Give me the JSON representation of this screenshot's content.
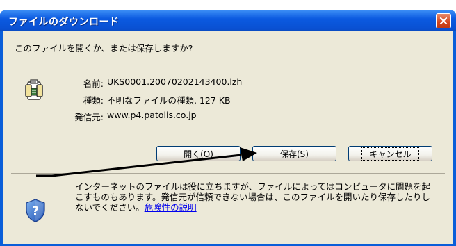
{
  "window": {
    "title": "ファイルのダウンロード",
    "close_label": "✕"
  },
  "dialog": {
    "question": "このファイルを開くか、または保存しますか?",
    "file": {
      "name_label": "名前:",
      "name_value": "UKS0001.20070202143400.lzh",
      "type_label": "種類:",
      "type_value": "不明なファイルの種類, 127 KB",
      "from_label": "発信元:",
      "from_value": "www.p4.patolis.co.jp"
    },
    "buttons": {
      "open": "開く(O)",
      "save": "保存(S)",
      "cancel": "キャンセル"
    },
    "warning": {
      "text": "インターネットのファイルは役に立ちますが、ファイルによってはコンピュータに問題を起こすものもあります。発信元が信頼できない場合は、このファイルを開いたり保存したりしないでください。",
      "link": "危険性の説明"
    }
  },
  "icons": {
    "file": "file-icon",
    "warning": "shield-question-icon",
    "close": "close-icon"
  },
  "colors": {
    "titlebar": "#0a5ed9",
    "close": "#d2451c",
    "client": "#ece9d8",
    "link": "#0000ee"
  }
}
